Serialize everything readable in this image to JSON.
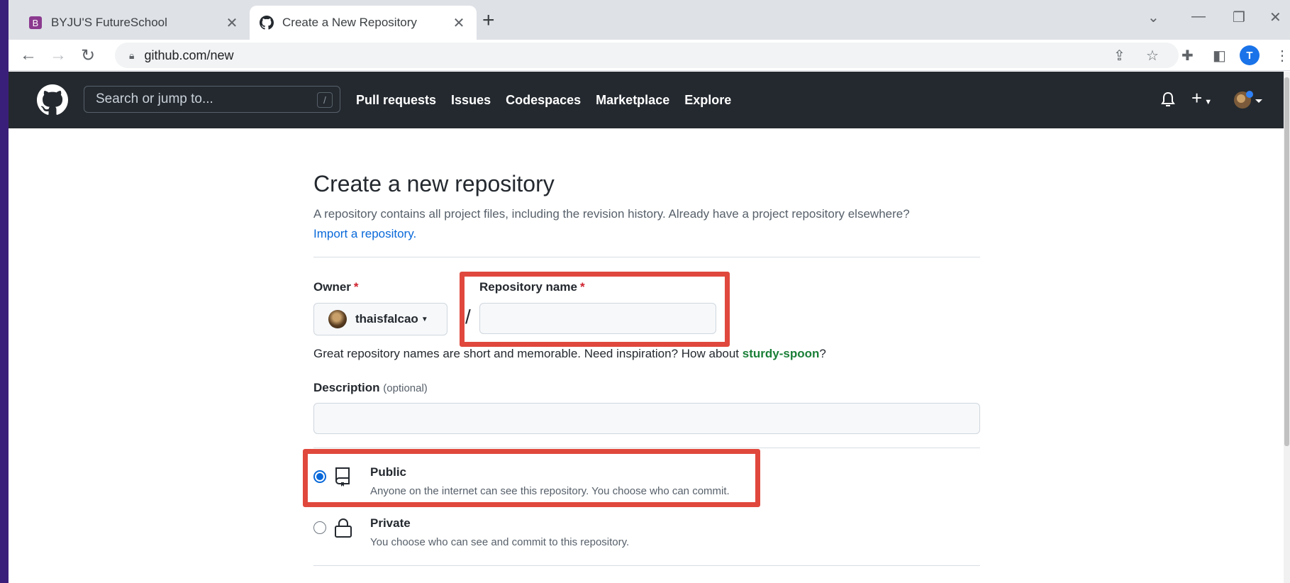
{
  "browser": {
    "tabs": [
      {
        "label": "BYJU'S FutureSchool",
        "active": false
      },
      {
        "label": "Create a New Repository",
        "active": true
      }
    ],
    "url": "github.com/new",
    "profile_initial": "T"
  },
  "github_header": {
    "search_placeholder": "Search or jump to...",
    "search_shortcut": "/",
    "nav": [
      "Pull requests",
      "Issues",
      "Codespaces",
      "Marketplace",
      "Explore"
    ]
  },
  "page": {
    "title": "Create a new repository",
    "subtitle": "A repository contains all project files, including the revision history. Already have a project repository elsewhere?",
    "import_link": "Import a repository.",
    "owner_label": "Owner",
    "owner_value": "thaisfalcao",
    "required_mark": "*",
    "separator": "/",
    "repo_name_label": "Repository name",
    "hint_prefix": "Great repository names are short and memorable. Need inspiration? How about",
    "hint_suggestion": "sturdy-spoon",
    "hint_suffix": "?",
    "description_label": "Description",
    "description_optional": "(optional)",
    "visibility": [
      {
        "title": "Public",
        "desc": "Anyone on the internet can see this repository. You choose who can commit.",
        "selected": true,
        "icon": "repo-icon"
      },
      {
        "title": "Private",
        "desc": "You choose who can see and commit to this repository.",
        "selected": false,
        "icon": "lock-icon"
      }
    ]
  },
  "colors": {
    "highlight": "#e0483d",
    "github_header": "#24292f",
    "link": "#0969da",
    "suggestion": "#1a7f37"
  }
}
